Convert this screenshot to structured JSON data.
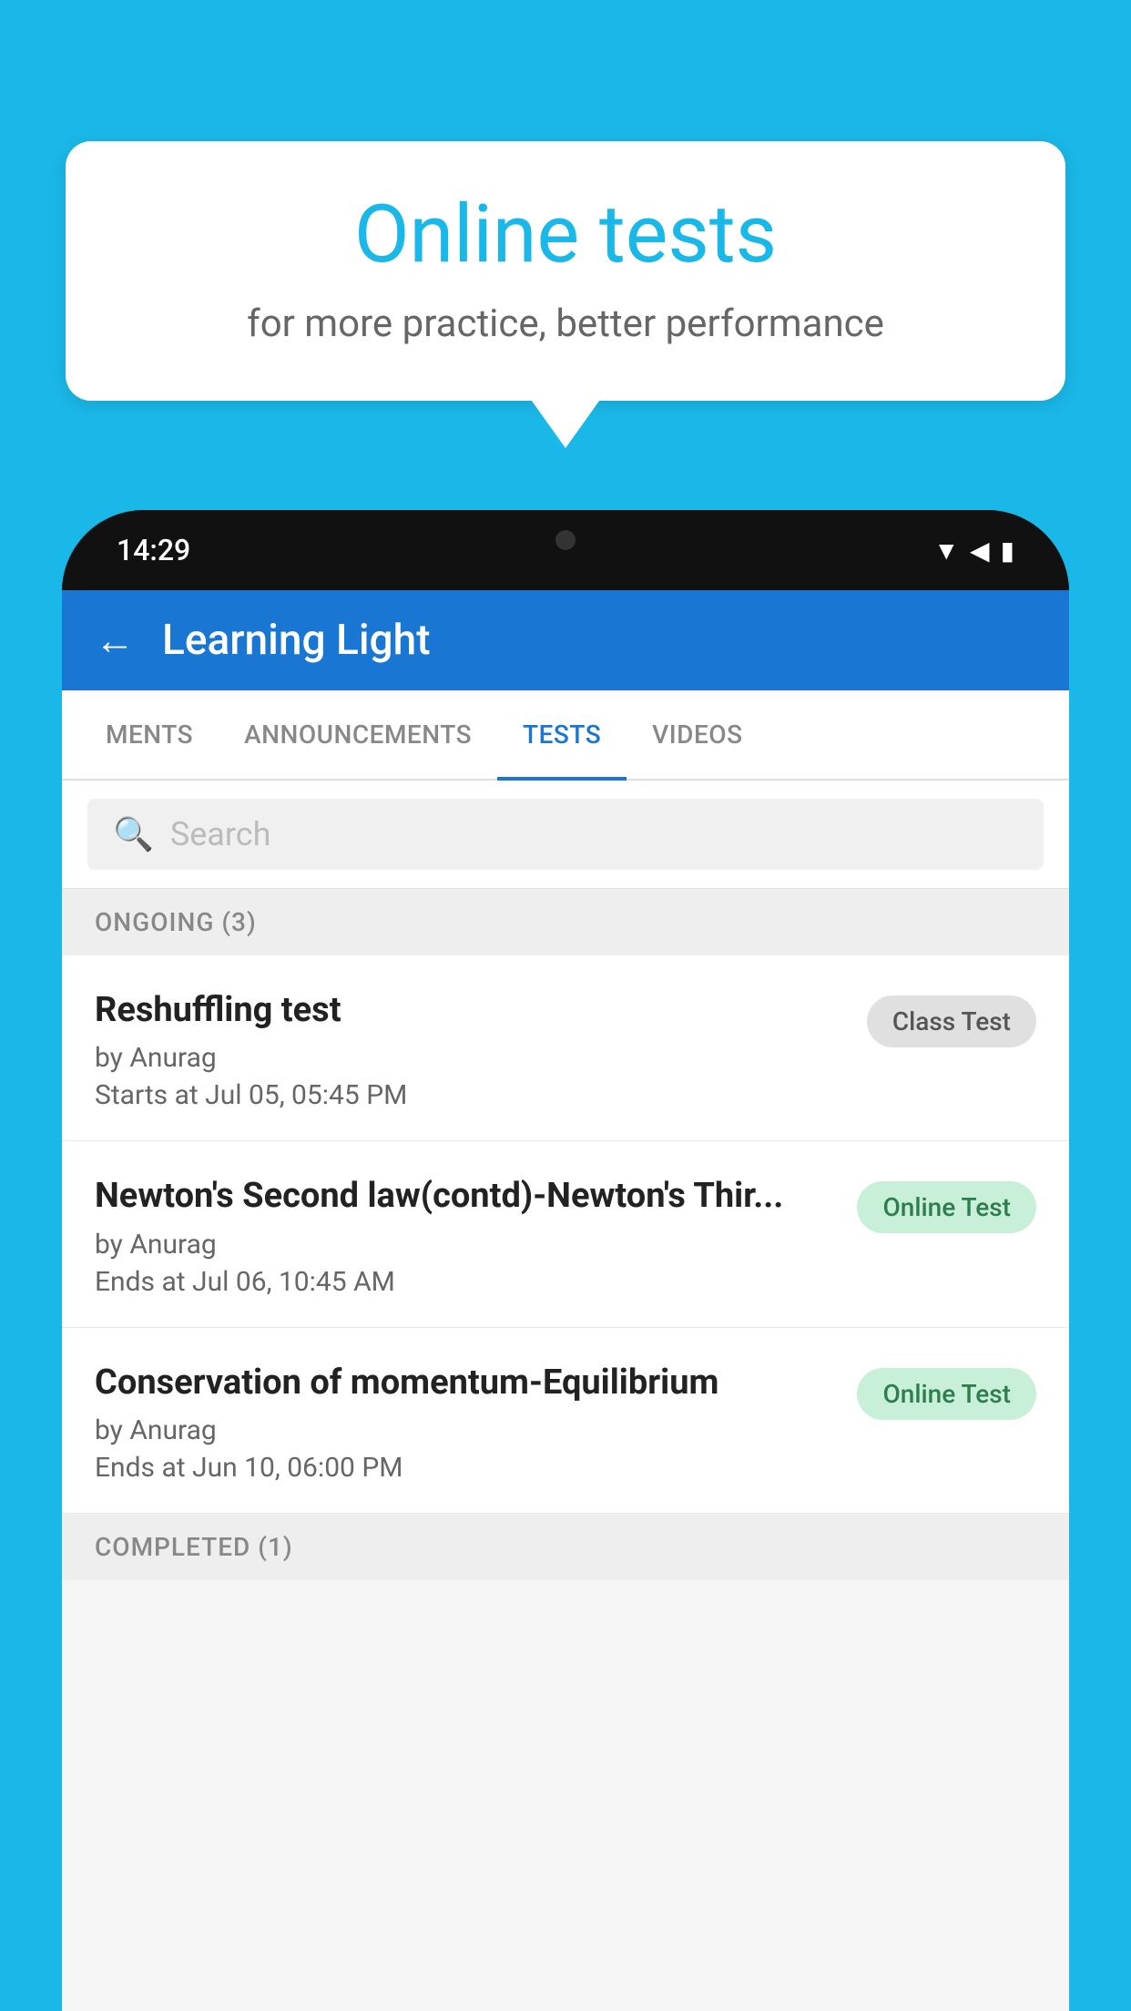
{
  "background_color": "#1ab8e8",
  "speech_bubble": {
    "title": "Online tests",
    "subtitle": "for more practice, better performance"
  },
  "phone": {
    "status_bar": {
      "time": "14:29",
      "icons": [
        "wifi",
        "signal",
        "battery"
      ]
    },
    "app": {
      "header": {
        "title": "Learning Light",
        "back_label": "←"
      },
      "tabs": [
        {
          "label": "MENTS",
          "active": false
        },
        {
          "label": "ANNOUNCEMENTS",
          "active": false
        },
        {
          "label": "TESTS",
          "active": true
        },
        {
          "label": "VIDEOS",
          "active": false
        }
      ],
      "search": {
        "placeholder": "Search"
      },
      "sections": [
        {
          "header": "ONGOING (3)",
          "items": [
            {
              "name": "Reshuffling test",
              "author": "by Anurag",
              "time": "Starts at  Jul 05, 05:45 PM",
              "badge": "Class Test",
              "badge_type": "class"
            },
            {
              "name": "Newton's Second law(contd)-Newton's Thir...",
              "author": "by Anurag",
              "time": "Ends at  Jul 06, 10:45 AM",
              "badge": "Online Test",
              "badge_type": "online"
            },
            {
              "name": "Conservation of momentum-Equilibrium",
              "author": "by Anurag",
              "time": "Ends at  Jun 10, 06:00 PM",
              "badge": "Online Test",
              "badge_type": "online"
            }
          ]
        },
        {
          "header": "COMPLETED (1)"
        }
      ]
    }
  }
}
